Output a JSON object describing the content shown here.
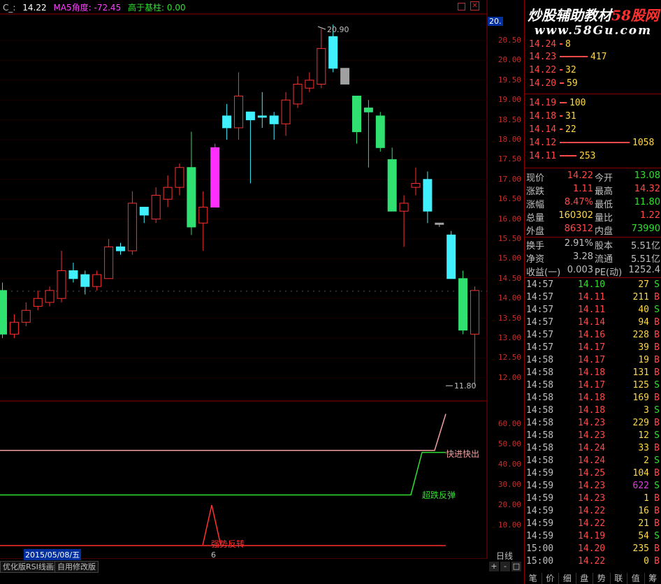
{
  "header": {
    "code": "C_:",
    "price": "14.22",
    "ma5_label": "MA5角度:",
    "ma5_value": "-72.45",
    "hist_label": "高于基柱:",
    "hist_value": "0.00"
  },
  "watermark": {
    "line1_a": "炒股辅助教材",
    "line1_b": "58股网",
    "line2": "www.58Gu.com"
  },
  "chart": {
    "high_label": "20.90",
    "low_label": "11.80",
    "axis_top_label": "20.",
    "ylabels": [
      "20.50",
      "20.00",
      "19.50",
      "19.00",
      "18.50",
      "18.00",
      "17.50",
      "17.00",
      "16.50",
      "16.00",
      "15.50",
      "15.00",
      "14.50",
      "14.00",
      "13.50",
      "13.00",
      "12.50",
      "12.00"
    ],
    "ind_ylabels": [
      "60.00",
      "50.00",
      "40.00",
      "30.00",
      "20.00",
      "10.00"
    ],
    "ind_labels": {
      "fast": "快进快出",
      "oversold": "超跌反弹",
      "strong": "强势反转"
    },
    "date_label": "2015/05/08/五",
    "cursor_label": "6",
    "tabs": [
      "优化版RSI线画线",
      "自用修改版"
    ],
    "period": "日线",
    "zoom_btns": [
      "+",
      "-",
      "□"
    ]
  },
  "chart_data": {
    "type": "candlestick",
    "candles": [
      {
        "o": 13.1,
        "c": 14.2,
        "h": 14.4,
        "l": 13.0,
        "color": "green"
      },
      {
        "o": 13.1,
        "c": 13.4,
        "h": 13.6,
        "l": 13.0,
        "color": "red"
      },
      {
        "o": 13.4,
        "c": 13.7,
        "h": 13.9,
        "l": 13.3,
        "color": "red"
      },
      {
        "o": 14.0,
        "c": 13.8,
        "h": 14.2,
        "l": 13.7,
        "color": "red"
      },
      {
        "o": 13.9,
        "c": 14.2,
        "h": 14.3,
        "l": 13.8,
        "color": "red"
      },
      {
        "o": 14.0,
        "c": 14.7,
        "h": 15.2,
        "l": 13.9,
        "color": "red"
      },
      {
        "o": 14.7,
        "c": 14.5,
        "h": 14.9,
        "l": 14.4,
        "color": "cyan"
      },
      {
        "o": 14.6,
        "c": 14.3,
        "h": 14.7,
        "l": 14.1,
        "color": "cyan"
      },
      {
        "o": 14.3,
        "c": 14.6,
        "h": 14.7,
        "l": 14.2,
        "color": "red"
      },
      {
        "o": 14.5,
        "c": 15.3,
        "h": 15.5,
        "l": 14.5,
        "color": "red"
      },
      {
        "o": 15.3,
        "c": 15.2,
        "h": 15.4,
        "l": 15.1,
        "color": "cyan"
      },
      {
        "o": 15.2,
        "c": 16.4,
        "h": 16.7,
        "l": 15.1,
        "color": "red"
      },
      {
        "o": 16.3,
        "c": 16.1,
        "h": 16.3,
        "l": 15.9,
        "color": "cyan"
      },
      {
        "o": 16.0,
        "c": 16.6,
        "h": 16.8,
        "l": 15.9,
        "color": "red"
      },
      {
        "o": 16.5,
        "c": 16.8,
        "h": 17.1,
        "l": 16.3,
        "color": "red"
      },
      {
        "o": 16.8,
        "c": 17.3,
        "h": 17.4,
        "l": 16.6,
        "color": "red"
      },
      {
        "o": 17.3,
        "c": 15.8,
        "h": 18.2,
        "l": 15.6,
        "color": "green"
      },
      {
        "o": 15.9,
        "c": 16.3,
        "h": 16.7,
        "l": 15.2,
        "color": "red"
      },
      {
        "o": 16.3,
        "c": 17.8,
        "h": 17.9,
        "l": 16.3,
        "color": "magenta"
      },
      {
        "o": 18.6,
        "c": 18.3,
        "h": 18.9,
        "l": 18.0,
        "color": "cyan"
      },
      {
        "o": 18.3,
        "c": 19.1,
        "h": 19.7,
        "l": 18.0,
        "color": "red"
      },
      {
        "o": 18.7,
        "c": 18.5,
        "h": 18.7,
        "l": 16.9,
        "color": "cyan"
      },
      {
        "o": 18.6,
        "c": 18.6,
        "h": 19.2,
        "l": 18.3,
        "color": "cyan"
      },
      {
        "o": 18.6,
        "c": 18.4,
        "h": 18.7,
        "l": 18.0,
        "color": "cyan"
      },
      {
        "o": 18.4,
        "c": 19.0,
        "h": 19.2,
        "l": 18.1,
        "color": "red"
      },
      {
        "o": 18.9,
        "c": 19.4,
        "h": 19.6,
        "l": 18.8,
        "color": "red"
      },
      {
        "o": 19.3,
        "c": 19.5,
        "h": 19.7,
        "l": 19.2,
        "color": "red"
      },
      {
        "o": 19.4,
        "c": 20.3,
        "h": 20.8,
        "l": 19.3,
        "color": "red"
      },
      {
        "o": 20.6,
        "c": 19.8,
        "h": 20.9,
        "l": 19.7,
        "color": "cyan"
      },
      {
        "o": 19.8,
        "c": 19.4,
        "h": 19.8,
        "l": 19.4,
        "color": "gray"
      },
      {
        "o": 19.1,
        "c": 18.2,
        "h": 19.1,
        "l": 17.9,
        "color": "green"
      },
      {
        "o": 18.8,
        "c": 18.7,
        "h": 19.0,
        "l": 17.3,
        "color": "green"
      },
      {
        "o": 18.6,
        "c": 17.8,
        "h": 18.7,
        "l": 17.7,
        "color": "green"
      },
      {
        "o": 17.5,
        "c": 16.2,
        "h": 17.8,
        "l": 16.2,
        "color": "green"
      },
      {
        "o": 16.2,
        "c": 16.4,
        "h": 16.6,
        "l": 15.3,
        "color": "red"
      },
      {
        "o": 16.8,
        "c": 16.9,
        "h": 17.3,
        "l": 16.6,
        "color": "red"
      },
      {
        "o": 17.0,
        "c": 16.2,
        "h": 17.2,
        "l": 15.9,
        "color": "cyan"
      },
      {
        "o": 15.9,
        "c": 15.9,
        "h": 15.9,
        "l": 15.8,
        "color": "gray"
      },
      {
        "o": 15.6,
        "c": 14.5,
        "h": 15.7,
        "l": 14.5,
        "color": "cyan"
      },
      {
        "o": 14.5,
        "c": 13.2,
        "h": 14.7,
        "l": 13.1,
        "color": "green"
      },
      {
        "o": 14.2,
        "c": 13.1,
        "h": 14.3,
        "l": 11.8,
        "color": "red"
      }
    ],
    "indicator": {
      "fast_level": 47,
      "oversold_before": 25,
      "oversold_after": 46,
      "strong_peak": 20,
      "fast_end": 65
    }
  },
  "orderbook": [
    {
      "price": "14.24",
      "vol": "8",
      "bar": 0.02
    },
    {
      "price": "14.23",
      "vol": "417",
      "bar": 0.4
    },
    {
      "price": "14.22",
      "vol": "32",
      "bar": 0.04
    },
    {
      "price": "14.20",
      "vol": "59",
      "bar": 0.06
    },
    {
      "price": "14.19",
      "vol": "100",
      "bar": 0.1
    },
    {
      "price": "14.18",
      "vol": "31",
      "bar": 0.04
    },
    {
      "price": "14.14",
      "vol": "22",
      "bar": 0.03
    },
    {
      "price": "14.12",
      "vol": "1058",
      "bar": 1.0
    },
    {
      "price": "14.11",
      "vol": "253",
      "bar": 0.24
    }
  ],
  "quotes": [
    [
      {
        "k": "现价",
        "v": "14.22",
        "c": "#ff4a4a"
      },
      {
        "k": "今开",
        "v": "13.08",
        "c": "#30e030"
      }
    ],
    [
      {
        "k": "涨跌",
        "v": "1.11",
        "c": "#ff4a4a"
      },
      {
        "k": "最高",
        "v": "14.32",
        "c": "#ff4a4a"
      }
    ],
    [
      {
        "k": "涨幅",
        "v": "8.47%",
        "c": "#ff4a4a"
      },
      {
        "k": "最低",
        "v": "11.80",
        "c": "#30e030"
      }
    ],
    [
      {
        "k": "总量",
        "v": "160302",
        "c": "#ffd84a"
      },
      {
        "k": "量比",
        "v": "1.22",
        "c": "#ff4a4a"
      }
    ],
    [
      {
        "k": "外盘",
        "v": "86312",
        "c": "#ff4a4a"
      },
      {
        "k": "内盘",
        "v": "73990",
        "c": "#30e030"
      }
    ],
    [
      {
        "k": "换手",
        "v": "2.91%",
        "c": "#c0c0c0"
      },
      {
        "k": "股本",
        "v": "5.51亿",
        "c": "#c0c0c0"
      }
    ],
    [
      {
        "k": "净资",
        "v": "3.28",
        "c": "#c0c0c0"
      },
      {
        "k": "流通",
        "v": "5.51亿",
        "c": "#c0c0c0"
      }
    ],
    [
      {
        "k": "收益(一)",
        "v": "0.003",
        "c": "#c0c0c0"
      },
      {
        "k": "PE(动)",
        "v": "1252.4",
        "c": "#c0c0c0"
      }
    ]
  ],
  "trades": [
    {
      "t": "14:57",
      "p": "14.10",
      "v": "27",
      "s": "S",
      "pc": "#30e030",
      "vc": "#ffd84a"
    },
    {
      "t": "14:57",
      "p": "14.11",
      "v": "211",
      "s": "B",
      "pc": "#ff4a4a",
      "vc": "#ffd84a"
    },
    {
      "t": "14:57",
      "p": "14.11",
      "v": "40",
      "s": "S",
      "pc": "#ff4a4a",
      "vc": "#ffd84a"
    },
    {
      "t": "14:57",
      "p": "14.14",
      "v": "94",
      "s": "B",
      "pc": "#ff4a4a",
      "vc": "#ffd84a"
    },
    {
      "t": "14:57",
      "p": "14.16",
      "v": "228",
      "s": "B",
      "pc": "#ff4a4a",
      "vc": "#ffd84a"
    },
    {
      "t": "14:57",
      "p": "14.17",
      "v": "39",
      "s": "B",
      "pc": "#ff4a4a",
      "vc": "#ffd84a"
    },
    {
      "t": "14:58",
      "p": "14.17",
      "v": "19",
      "s": "B",
      "pc": "#ff4a4a",
      "vc": "#ffd84a"
    },
    {
      "t": "14:58",
      "p": "14.18",
      "v": "131",
      "s": "B",
      "pc": "#ff4a4a",
      "vc": "#ffd84a"
    },
    {
      "t": "14:58",
      "p": "14.17",
      "v": "125",
      "s": "S",
      "pc": "#ff4a4a",
      "vc": "#ffd84a"
    },
    {
      "t": "14:58",
      "p": "14.18",
      "v": "169",
      "s": "B",
      "pc": "#ff4a4a",
      "vc": "#ffd84a"
    },
    {
      "t": "14:58",
      "p": "14.18",
      "v": "3",
      "s": "S",
      "pc": "#ff4a4a",
      "vc": "#ffd84a"
    },
    {
      "t": "14:58",
      "p": "14.23",
      "v": "229",
      "s": "B",
      "pc": "#ff4a4a",
      "vc": "#ffd84a"
    },
    {
      "t": "14:58",
      "p": "14.23",
      "v": "12",
      "s": "S",
      "pc": "#ff4a4a",
      "vc": "#ffd84a"
    },
    {
      "t": "14:58",
      "p": "14.24",
      "v": "33",
      "s": "B",
      "pc": "#ff4a4a",
      "vc": "#ffd84a"
    },
    {
      "t": "14:58",
      "p": "14.24",
      "v": "2",
      "s": "S",
      "pc": "#ff4a4a",
      "vc": "#ffd84a"
    },
    {
      "t": "14:59",
      "p": "14.25",
      "v": "104",
      "s": "B",
      "pc": "#ff4a4a",
      "vc": "#ffd84a"
    },
    {
      "t": "14:59",
      "p": "14.23",
      "v": "622",
      "s": "S",
      "pc": "#ff4a4a",
      "vc": "#e040e0"
    },
    {
      "t": "14:59",
      "p": "14.23",
      "v": "1",
      "s": "B",
      "pc": "#ff4a4a",
      "vc": "#ffd84a"
    },
    {
      "t": "14:59",
      "p": "14.22",
      "v": "16",
      "s": "B",
      "pc": "#ff4a4a",
      "vc": "#ffd84a"
    },
    {
      "t": "14:59",
      "p": "14.22",
      "v": "21",
      "s": "B",
      "pc": "#ff4a4a",
      "vc": "#ffd84a"
    },
    {
      "t": "14:59",
      "p": "14.19",
      "v": "54",
      "s": "S",
      "pc": "#ff4a4a",
      "vc": "#ffd84a"
    },
    {
      "t": "15:00",
      "p": "14.20",
      "v": "235",
      "s": "B",
      "pc": "#ff4a4a",
      "vc": "#ffd84a"
    },
    {
      "t": "15:00",
      "p": "14.22",
      "v": "0",
      "s": "B",
      "pc": "#ff4a4a",
      "vc": "#ffd84a"
    }
  ],
  "panel_tabs": [
    "笔",
    "价",
    "细",
    "盘",
    "势",
    "联",
    "值",
    "筹"
  ]
}
